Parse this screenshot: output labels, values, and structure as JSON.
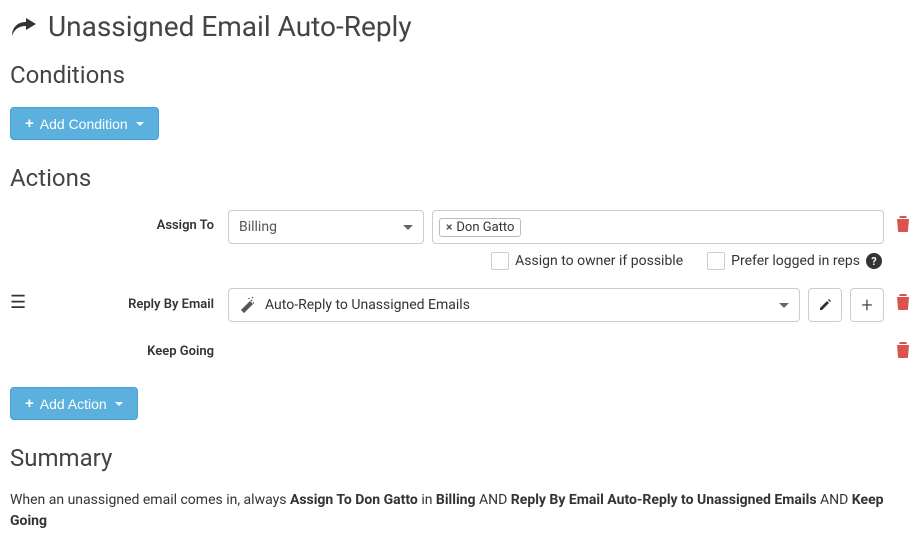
{
  "page_title": "Unassigned Email Auto-Reply",
  "sections": {
    "conditions_heading": "Conditions",
    "actions_heading": "Actions",
    "summary_heading": "Summary"
  },
  "buttons": {
    "add_condition": "Add Condition",
    "add_action": "Add Action"
  },
  "actions": {
    "assign_to": {
      "label": "Assign To",
      "department": "Billing",
      "tags": [
        "Don Gatto"
      ],
      "assign_owner_label": "Assign to owner if possible",
      "prefer_logged_label": "Prefer logged in reps"
    },
    "reply_by_email": {
      "label": "Reply By Email",
      "template": "Auto-Reply to Unassigned Emails"
    },
    "keep_going": {
      "label": "Keep Going"
    }
  },
  "summary": {
    "prefix": "When an unassigned email comes in, always ",
    "part1_bold": "Assign To Don Gatto",
    "part1_mid": " in ",
    "part1_bold2": "Billing",
    "and1": " AND ",
    "part2_bold": "Reply By Email Auto-Reply to Unassigned Emails",
    "and2": " AND ",
    "part3_bold": "Keep Going"
  }
}
